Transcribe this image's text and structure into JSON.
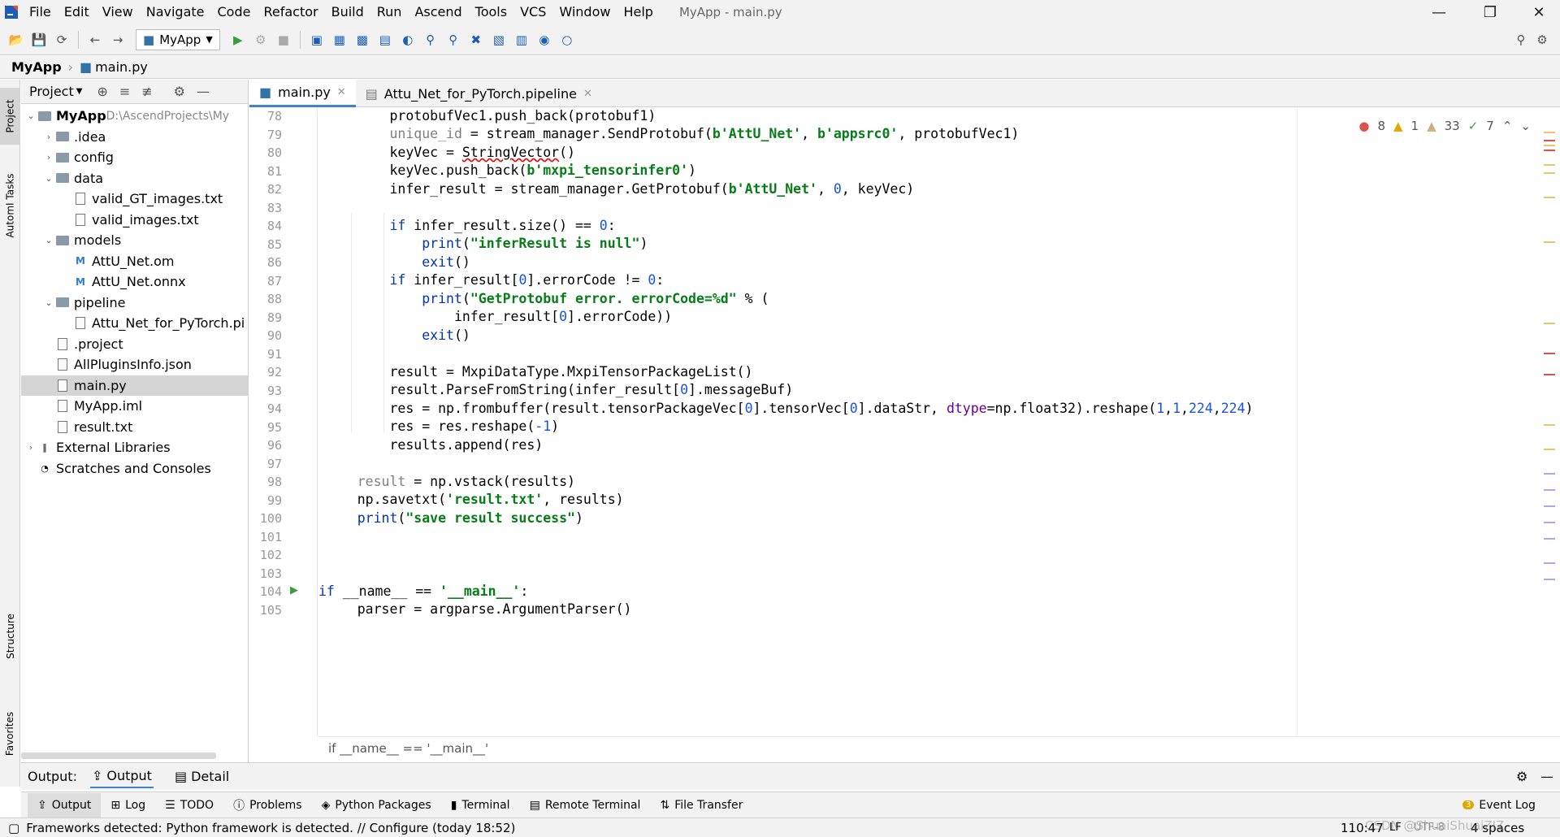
{
  "menubar": {
    "items": [
      "File",
      "Edit",
      "View",
      "Navigate",
      "Code",
      "Refactor",
      "Build",
      "Run",
      "Ascend",
      "Tools",
      "VCS",
      "Window",
      "Help"
    ],
    "title": "MyApp - main.py"
  },
  "toolbar": {
    "run_config": "MyApp"
  },
  "breadcrumb": {
    "project": "MyApp",
    "file": "main.py"
  },
  "side_tabs": {
    "project": "Project",
    "automl": "AutomI Tasks",
    "structure": "Structure",
    "favorites": "Favorites"
  },
  "project_panel": {
    "header": "Project",
    "tree": [
      {
        "label": "MyApp",
        "extra": "D:\\AscendProjects\\My",
        "depth": 0,
        "type": "folder",
        "arrow": "open",
        "bold": true
      },
      {
        "label": ".idea",
        "depth": 1,
        "type": "folder",
        "arrow": "closed"
      },
      {
        "label": "config",
        "depth": 1,
        "type": "folder",
        "arrow": "closed"
      },
      {
        "label": "data",
        "depth": 1,
        "type": "folder",
        "arrow": "open"
      },
      {
        "label": "valid_GT_images.txt",
        "depth": 2,
        "type": "file"
      },
      {
        "label": "valid_images.txt",
        "depth": 2,
        "type": "file"
      },
      {
        "label": "models",
        "depth": 1,
        "type": "folder",
        "arrow": "open"
      },
      {
        "label": "AttU_Net.om",
        "depth": 2,
        "type": "mfile"
      },
      {
        "label": "AttU_Net.onnx",
        "depth": 2,
        "type": "mfile"
      },
      {
        "label": "pipeline",
        "depth": 1,
        "type": "folder",
        "arrow": "open"
      },
      {
        "label": "Attu_Net_for_PyTorch.pi",
        "depth": 2,
        "type": "file"
      },
      {
        "label": ".project",
        "depth": 1,
        "type": "file"
      },
      {
        "label": "AllPluginsInfo.json",
        "depth": 1,
        "type": "file"
      },
      {
        "label": "main.py",
        "depth": 1,
        "type": "file",
        "selected": true
      },
      {
        "label": "MyApp.iml",
        "depth": 1,
        "type": "file"
      },
      {
        "label": "result.txt",
        "depth": 1,
        "type": "file"
      },
      {
        "label": "External Libraries",
        "depth": 0,
        "type": "lib",
        "arrow": "closed"
      },
      {
        "label": "Scratches and Consoles",
        "depth": 0,
        "type": "scratch"
      }
    ]
  },
  "editor": {
    "tabs": [
      {
        "label": "main.py",
        "active": true
      },
      {
        "label": "Attu_Net_for_PyTorch.pipeline",
        "active": false
      }
    ],
    "inspections": {
      "errors": "8",
      "warnings": "1",
      "weak": "33",
      "ok": "7"
    },
    "line_numbers": [
      "78",
      "79",
      "80",
      "81",
      "82",
      "83",
      "84",
      "85",
      "86",
      "87",
      "88",
      "89",
      "90",
      "91",
      "92",
      "93",
      "94",
      "95",
      "96",
      "97",
      "98",
      "99",
      "100",
      "101",
      "102",
      "103",
      "104",
      "105"
    ],
    "breadcrumb": "if __name__ == '__main__'"
  },
  "output": {
    "label": "Output:",
    "tabs": [
      "Output",
      "Detail"
    ]
  },
  "bottom_tabs": [
    "Output",
    "Log",
    "TODO",
    "Problems",
    "Python Packages",
    "Terminal",
    "Remote Terminal",
    "File Transfer"
  ],
  "event_log": {
    "label": "Event Log",
    "count": "3"
  },
  "status": {
    "message": "Frameworks detected: Python framework is detected. // Configure (today 18:52)",
    "position": "110:47",
    "line_sep": "LF",
    "encoding": "UTF-8",
    "indent": "4 spaces",
    "watermark": "CSDN @ShuaiShuaiZIZ"
  },
  "colors": {
    "keyword": "#0033b3",
    "string": "#067d17",
    "number": "#1750eb",
    "kwarg": "#660099",
    "accent": "#4083c9"
  }
}
